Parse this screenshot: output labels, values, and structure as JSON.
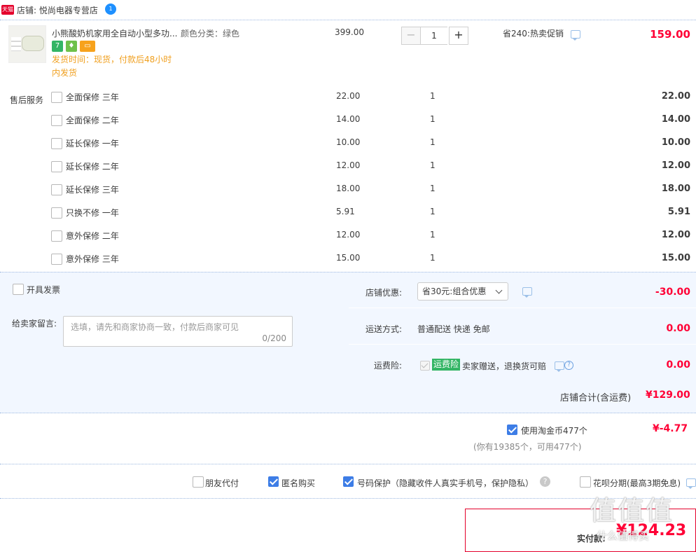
{
  "shop": {
    "badge": "天猫",
    "name": "店铺: 悦尚电器专营店",
    "ww_badge": "1"
  },
  "product": {
    "title": "小熊酸奶机家用全自动小型多功...",
    "sku": "颜色分类：绿色",
    "badge_7": "7",
    "delivery": "发货时间：现货，付款后48小时内发货",
    "unit_price": "399.00",
    "qty": "1",
    "qty_minus": "−",
    "qty_plus": "+",
    "promo": "省240:热卖促销",
    "total": "159.00"
  },
  "service": {
    "label": "售后服务",
    "rows": [
      {
        "name": "全面保修 三年",
        "price": "22.00",
        "qty": "1",
        "total": "22.00"
      },
      {
        "name": "全面保修 二年",
        "price": "14.00",
        "qty": "1",
        "total": "14.00"
      },
      {
        "name": "延长保修 一年",
        "price": "10.00",
        "qty": "1",
        "total": "10.00"
      },
      {
        "name": "延长保修 二年",
        "price": "12.00",
        "qty": "1",
        "total": "12.00"
      },
      {
        "name": "延长保修 三年",
        "price": "18.00",
        "qty": "1",
        "total": "18.00"
      },
      {
        "name": "只换不修 一年",
        "price": "5.91",
        "qty": "1",
        "total": "5.91"
      },
      {
        "name": "意外保修 二年",
        "price": "12.00",
        "qty": "1",
        "total": "12.00"
      },
      {
        "name": "意外保修 三年",
        "price": "15.00",
        "qty": "1",
        "total": "15.00"
      }
    ]
  },
  "options": {
    "invoice": "开具发票",
    "note_label": "给卖家留言:",
    "note_placeholder": "选填，请先和商家协商一致，付款后商家可见",
    "note_count": "0/200",
    "coupon_label": "店铺优惠:",
    "coupon_value": "省30元:组合优惠",
    "coupon_amount": "-30.00",
    "shipping_label": "运送方式:",
    "shipping_value": "普通配送 快递 免邮",
    "shipping_amount": "0.00",
    "insurance_label": "运费险:",
    "insurance_tag": "运费险",
    "insurance_text": "卖家赠送，退换货可赔",
    "insurance_amount": "0.00",
    "shop_total_label": "店铺合计(含运费)",
    "shop_total": "¥129.00"
  },
  "coins": {
    "label": "使用淘金币477个",
    "amount": "¥-4.77",
    "note": "(你有19385个，可用477个)"
  },
  "bottom": {
    "friend_pay": "朋友代付",
    "anonymous": "匿名购买",
    "number_protect": "号码保护（隐藏收件人真实手机号，保护隐私）",
    "help": "?",
    "huabei": "花呗分期(最高3期免息)"
  },
  "pay": {
    "label": "实付款:",
    "amount": "¥124.23"
  },
  "watermark": {
    "text": "值值值",
    "url": "什么值得买"
  },
  "colors": {
    "price_red": "#ff0036",
    "accent_blue": "#3d7de6",
    "panel_bg": "#f2f7ff",
    "tmall_red": "#e4002b"
  }
}
